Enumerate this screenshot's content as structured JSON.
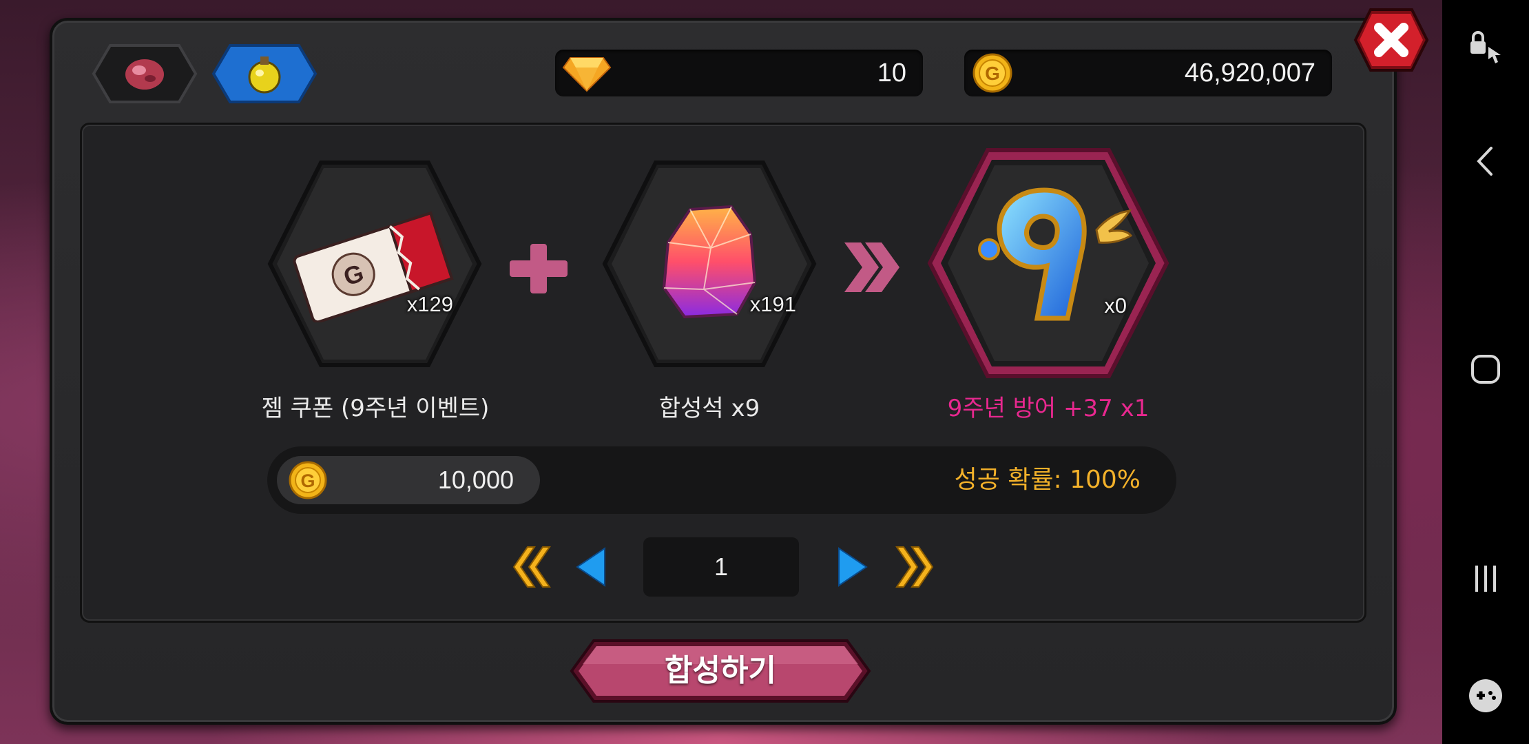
{
  "resources": {
    "gems": "10",
    "gold": "46,920,007"
  },
  "recipe": {
    "ingredient1": {
      "name": "젬 쿠폰 (9주년 이벤트)",
      "qty": "x129",
      "icon": "gem-coupon-ticket-icon"
    },
    "ingredient2": {
      "name": "합성석 x9",
      "qty": "x191",
      "icon": "synthesis-stone-icon"
    },
    "result": {
      "name": "9주년 방어 +37 x1",
      "qty": "x0",
      "icon": "ninth-anniversary-defense-icon"
    }
  },
  "cost": {
    "gold": "10,000",
    "success_rate": "성공 확률: 100%"
  },
  "pagination": {
    "page": "1"
  },
  "actions": {
    "synthesize_label": "합성하기"
  },
  "colors": {
    "accent_pink": "#e8288f",
    "rate_orange": "#f3b12a",
    "button_pink": "#b8476e"
  }
}
